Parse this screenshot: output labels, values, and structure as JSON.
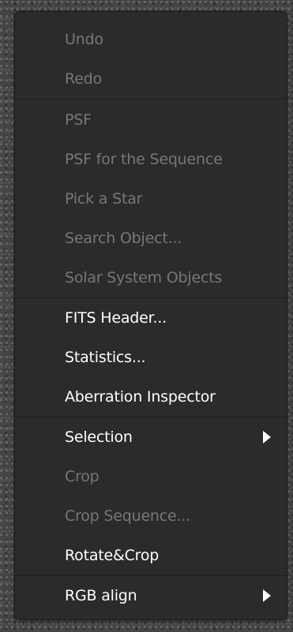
{
  "context_menu": {
    "items": [
      {
        "label": "Undo",
        "enabled": false
      },
      {
        "label": "Redo",
        "enabled": false
      },
      {
        "label": "PSF",
        "enabled": false
      },
      {
        "label": "PSF for the Sequence",
        "enabled": false
      },
      {
        "label": "Pick a Star",
        "enabled": false
      },
      {
        "label": "Search Object...",
        "enabled": false
      },
      {
        "label": "Solar System Objects",
        "enabled": false
      },
      {
        "label": "FITS Header...",
        "enabled": true
      },
      {
        "label": "Statistics...",
        "enabled": true
      },
      {
        "label": "Aberration Inspector",
        "enabled": true
      },
      {
        "label": "Selection",
        "enabled": true,
        "submenu": true,
        "icon": "chevron-right-icon"
      },
      {
        "label": "Crop",
        "enabled": false
      },
      {
        "label": "Crop Sequence...",
        "enabled": false
      },
      {
        "label": "Rotate&Crop",
        "enabled": true
      },
      {
        "label": "RGB align",
        "enabled": true,
        "submenu": true,
        "icon": "chevron-right-icon"
      }
    ]
  },
  "colors": {
    "menu_background": "#2b2b2b",
    "enabled_text": "#ffffff",
    "disabled_text": "#777777",
    "separator": "#202020"
  }
}
